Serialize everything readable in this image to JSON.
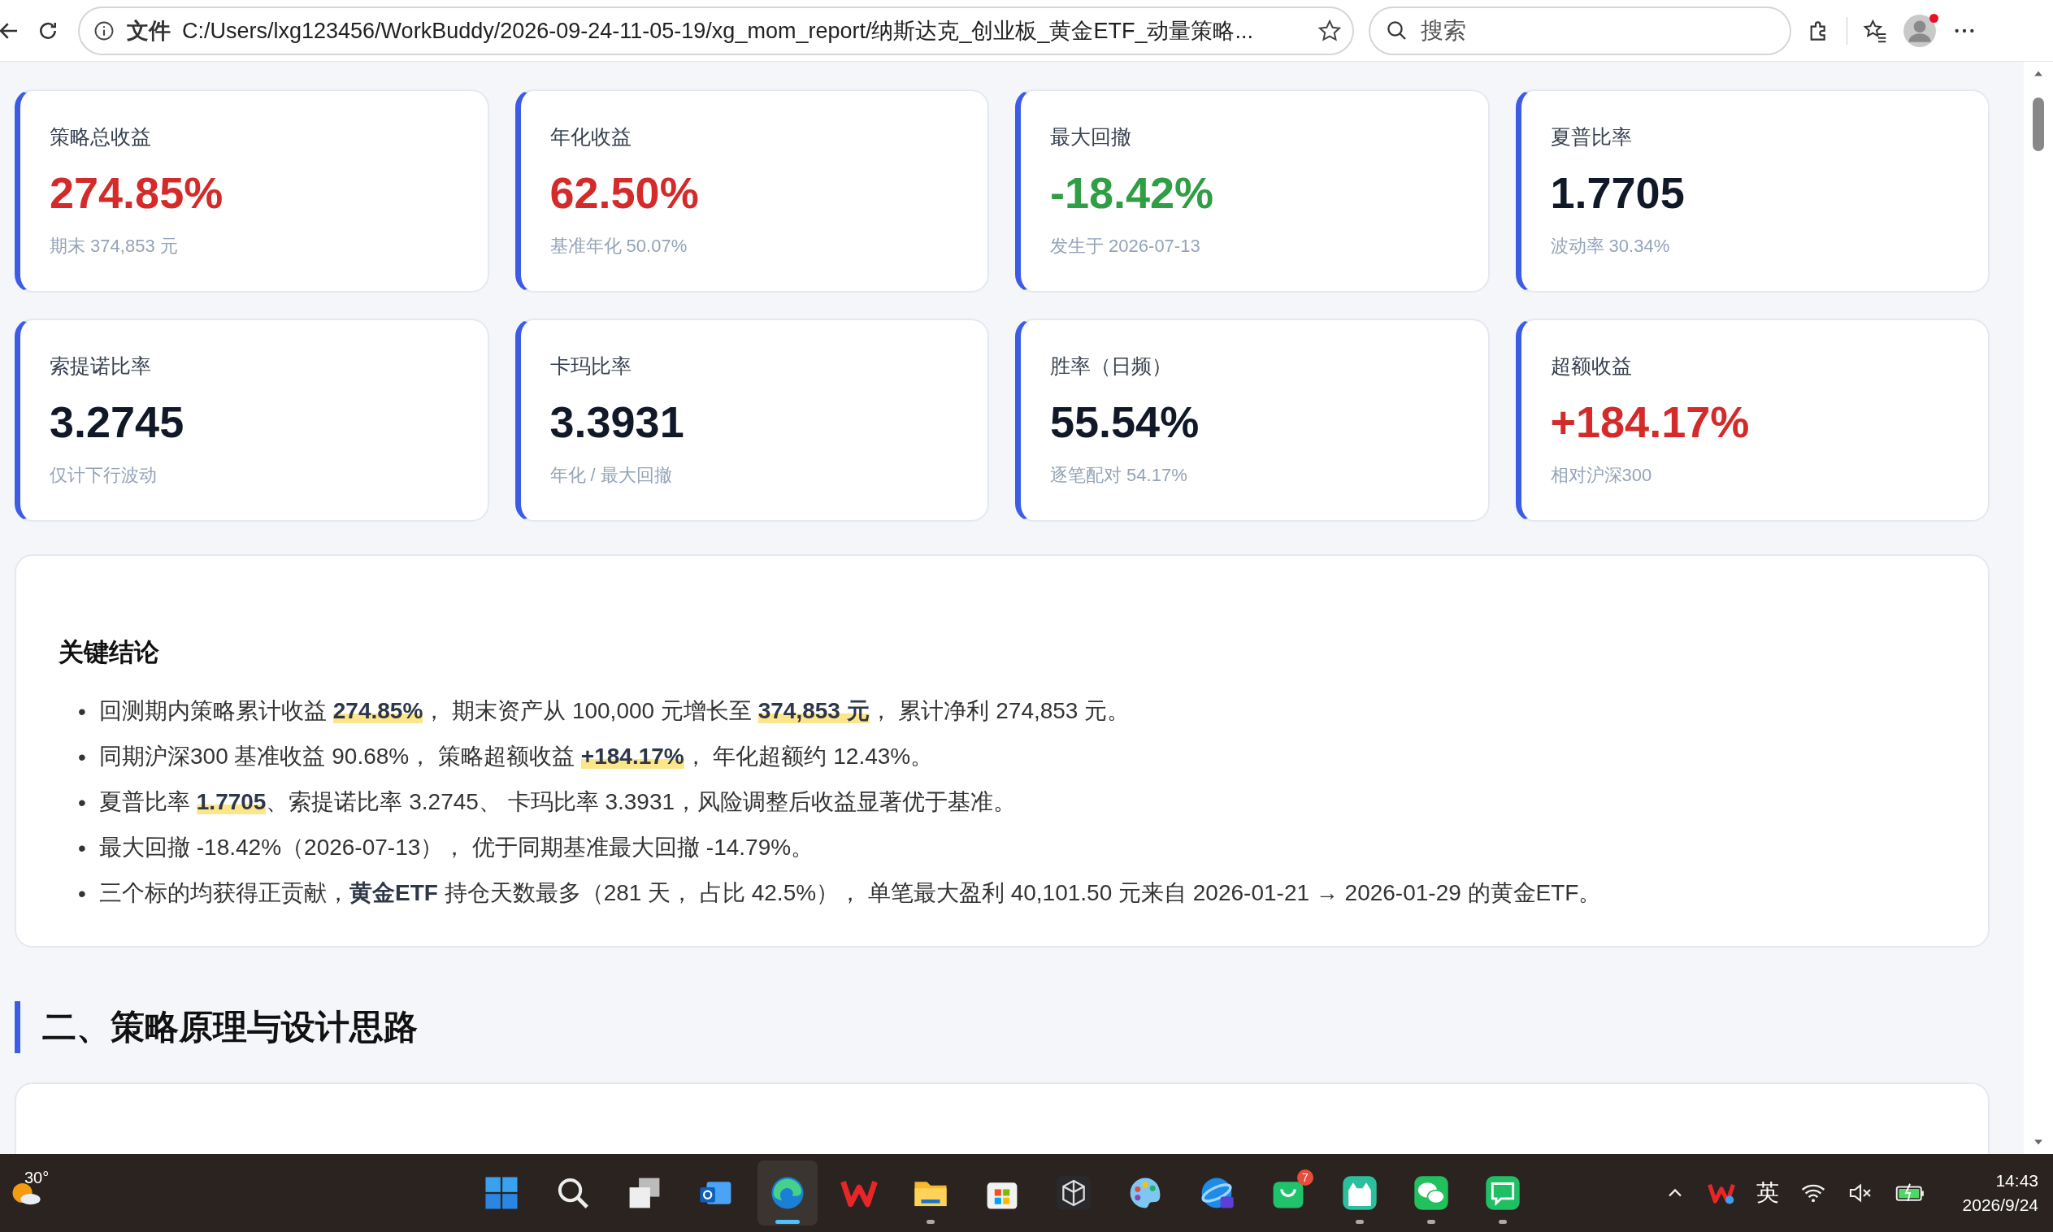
{
  "browser": {
    "file_label": "文件",
    "url": "C:/Users/lxg123456/WorkBuddy/2026-09-24-11-05-19/xg_mom_report/纳斯达克_创业板_黄金ETF_动量策略...",
    "search_placeholder": "搜索",
    "profile_notification": true
  },
  "cards": [
    {
      "label": "策略总收益",
      "value": "274.85%",
      "color": "#d42a2a",
      "sub": "期末 374,853 元"
    },
    {
      "label": "年化收益",
      "value": "62.50%",
      "color": "#d42a2a",
      "sub": "基准年化 50.07%"
    },
    {
      "label": "最大回撤",
      "value": "-18.42%",
      "color": "#2f9e44",
      "sub": "发生于 2026-07-13"
    },
    {
      "label": "夏普比率",
      "value": "1.7705",
      "color": "#111827",
      "sub": "波动率 30.34%"
    },
    {
      "label": "索提诺比率",
      "value": "3.2745",
      "color": "#111827",
      "sub": "仅计下行波动"
    },
    {
      "label": "卡玛比率",
      "value": "3.3931",
      "color": "#111827",
      "sub": "年化 / 最大回撤"
    },
    {
      "label": "胜率（日频）",
      "value": "55.54%",
      "color": "#111827",
      "sub": "逐笔配对 54.17%"
    },
    {
      "label": "超额收益",
      "value": "+184.17%",
      "color": "#d42a2a",
      "sub": "相对沪深300"
    }
  ],
  "conclusions": {
    "title": "关键结论",
    "items": [
      {
        "bullet": "•",
        "parts": [
          {
            "text": "回测期内策略累计收益 ",
            "kind": "plain"
          },
          {
            "text": "274.85%",
            "kind": "mark"
          },
          {
            "text": "， 期末资产从 100,000 元增长至 ",
            "kind": "plain"
          },
          {
            "text": "374,853 元",
            "kind": "mark"
          },
          {
            "text": "， 累计净利 274,853 元。",
            "kind": "plain"
          }
        ]
      },
      {
        "bullet": "•",
        "parts": [
          {
            "text": "同期沪深300 基准收益 90.68%， 策略超额收益 ",
            "kind": "plain"
          },
          {
            "text": "+184.17%",
            "kind": "mark"
          },
          {
            "text": "， 年化超额约 12.43%。",
            "kind": "plain"
          }
        ]
      },
      {
        "bullet": "•",
        "parts": [
          {
            "text": "夏普比率 ",
            "kind": "plain"
          },
          {
            "text": "1.7705",
            "kind": "mark"
          },
          {
            "text": "、索提诺比率 3.2745、 卡玛比率 3.3931，风险调整后收益显著优于基准。",
            "kind": "plain"
          }
        ]
      },
      {
        "bullet": "•",
        "parts": [
          {
            "text": "最大回撤 -18.42%（2026-07-13）， 优于同期基准最大回撤 -14.79%。",
            "kind": "plain"
          }
        ]
      },
      {
        "bullet": "•",
        "parts": [
          {
            "text": "三个标的均获得正贡献，",
            "kind": "plain"
          },
          {
            "text": "黄金ETF",
            "kind": "bold"
          },
          {
            "text": " 持仓天数最多（281 天， 占比 42.5%）， 单笔最大盈利 40,101.50 元来自 2026-01-21 → 2026-01-29 的黄金ETF。",
            "kind": "plain"
          }
        ]
      }
    ]
  },
  "section_title": "二、策略原理与设计思路",
  "taskbar": {
    "weather": "30°",
    "apps": [
      {
        "kind": "start",
        "running": false,
        "selected": false
      },
      {
        "kind": "search",
        "running": false,
        "selected": false
      },
      {
        "kind": "taskview",
        "running": false,
        "selected": false
      },
      {
        "kind": "mail",
        "running": false,
        "selected": false
      },
      {
        "kind": "browser",
        "running": true,
        "selected": true
      },
      {
        "kind": "zigzag",
        "running": false,
        "selected": false
      },
      {
        "kind": "folder",
        "running": true,
        "selected": false
      },
      {
        "kind": "store",
        "running": false,
        "selected": false
      },
      {
        "kind": "cube",
        "running": false,
        "selected": false
      },
      {
        "kind": "palette",
        "running": false,
        "selected": false
      },
      {
        "kind": "globe",
        "running": false,
        "selected": false
      },
      {
        "kind": "bag",
        "running": false,
        "selected": false,
        "badge": "7"
      },
      {
        "kind": "cat",
        "running": true,
        "selected": false
      },
      {
        "kind": "chat",
        "running": true,
        "selected": false
      },
      {
        "kind": "message",
        "running": true,
        "selected": false
      }
    ],
    "ime": "英",
    "volume_muted": true,
    "time": "14:43",
    "date": "2026/9/24"
  }
}
